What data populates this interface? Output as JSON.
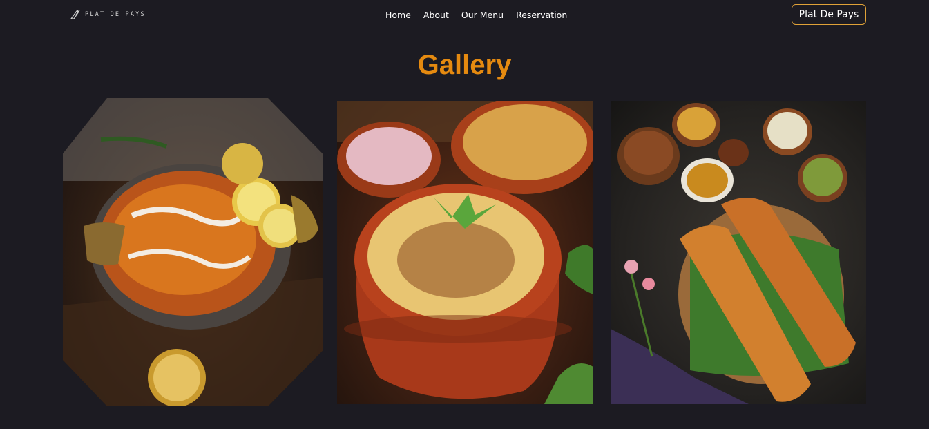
{
  "brand": {
    "name": "PLAT DE PAYS"
  },
  "nav": {
    "links": [
      "Home",
      "About",
      "Our Menu",
      "Reservation"
    ],
    "cta_label": "Plat De Pays"
  },
  "gallery": {
    "title": "Gallery"
  },
  "colors": {
    "background": "#1c1b22",
    "accent": "#e58a10",
    "button_border": "#e0a238"
  },
  "icons": [
    "knife-fork-logo-icon"
  ]
}
